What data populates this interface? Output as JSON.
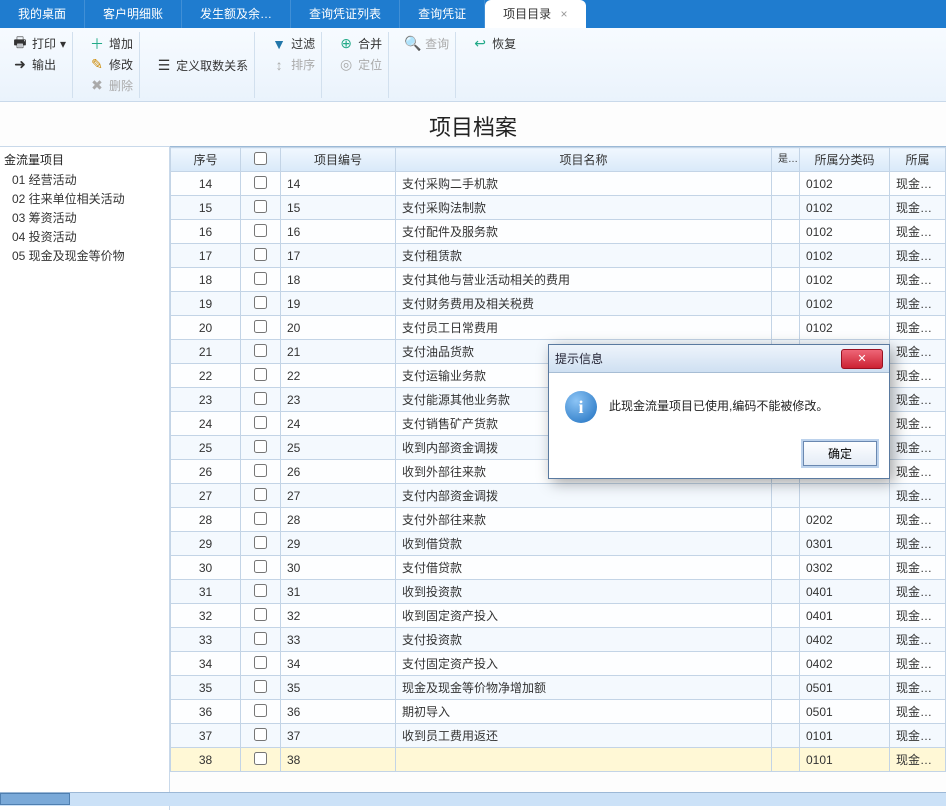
{
  "tabs": [
    {
      "label": "我的桌面",
      "active": false
    },
    {
      "label": "客户明细账",
      "active": false
    },
    {
      "label": "发生额及余…",
      "active": false
    },
    {
      "label": "查询凭证列表",
      "active": false
    },
    {
      "label": "查询凭证",
      "active": false
    },
    {
      "label": "项目目录",
      "active": true
    }
  ],
  "ribbon": {
    "print": "打印",
    "export": "输出",
    "add": "增加",
    "edit": "修改",
    "delete": "删除",
    "define": "定义取数关系",
    "filter": "过滤",
    "sort": "排序",
    "merge": "合并",
    "locate": "定位",
    "query": "查询",
    "restore": "恢复"
  },
  "page_title": "项目档案",
  "tree": {
    "root": "金流量项目",
    "items": [
      {
        "label": "01 经营活动"
      },
      {
        "label": "02 往来单位相关活动"
      },
      {
        "label": "03 筹资活动"
      },
      {
        "label": "04 投资活动"
      },
      {
        "label": "05 现金及现金等价物"
      }
    ]
  },
  "columns": {
    "seq": "序号",
    "chk": "",
    "code": "项目编号",
    "name": "项目名称",
    "settle": "是否结算",
    "cls": "所属分类码",
    "dir": "所属"
  },
  "rows": [
    {
      "seq": "14",
      "code": "14",
      "name": "支付采购二手机款",
      "cls": "0102",
      "dir": "现金流出"
    },
    {
      "seq": "15",
      "code": "15",
      "name": "支付采购法制款",
      "cls": "0102",
      "dir": "现金流出"
    },
    {
      "seq": "16",
      "code": "16",
      "name": "支付配件及服务款",
      "cls": "0102",
      "dir": "现金流出"
    },
    {
      "seq": "17",
      "code": "17",
      "name": "支付租赁款",
      "cls": "0102",
      "dir": "现金流出"
    },
    {
      "seq": "18",
      "code": "18",
      "name": "支付其他与营业活动相关的费用",
      "cls": "0102",
      "dir": "现金流出"
    },
    {
      "seq": "19",
      "code": "19",
      "name": "支付财务费用及相关税费",
      "cls": "0102",
      "dir": "现金流出"
    },
    {
      "seq": "20",
      "code": "20",
      "name": "支付员工日常费用",
      "cls": "0102",
      "dir": "现金流出"
    },
    {
      "seq": "21",
      "code": "21",
      "name": "支付油品货款",
      "cls": "",
      "dir": "现金流出"
    },
    {
      "seq": "22",
      "code": "22",
      "name": "支付运输业务款",
      "cls": "",
      "dir": "现金流出"
    },
    {
      "seq": "23",
      "code": "23",
      "name": "支付能源其他业务款",
      "cls": "",
      "dir": "现金流出"
    },
    {
      "seq": "24",
      "code": "24",
      "name": "支付销售矿产货款",
      "cls": "",
      "dir": "现金流出"
    },
    {
      "seq": "25",
      "code": "25",
      "name": "收到内部资金调拨",
      "cls": "",
      "dir": "现金流入"
    },
    {
      "seq": "26",
      "code": "26",
      "name": "收到外部往来款",
      "cls": "",
      "dir": "现金流入"
    },
    {
      "seq": "27",
      "code": "27",
      "name": "支付内部资金调拨",
      "cls": "",
      "dir": "现金流出"
    },
    {
      "seq": "28",
      "code": "28",
      "name": "支付外部往来款",
      "cls": "0202",
      "dir": "现金流出"
    },
    {
      "seq": "29",
      "code": "29",
      "name": "收到借贷款",
      "cls": "0301",
      "dir": "现金流入"
    },
    {
      "seq": "30",
      "code": "30",
      "name": "支付借贷款",
      "cls": "0302",
      "dir": "现金流出"
    },
    {
      "seq": "31",
      "code": "31",
      "name": "收到投资款",
      "cls": "0401",
      "dir": "现金流入"
    },
    {
      "seq": "32",
      "code": "32",
      "name": "收到固定资产投入",
      "cls": "0401",
      "dir": "现金流入"
    },
    {
      "seq": "33",
      "code": "33",
      "name": "支付投资款",
      "cls": "0402",
      "dir": "现金流出"
    },
    {
      "seq": "34",
      "code": "34",
      "name": "支付固定资产投入",
      "cls": "0402",
      "dir": "现金流出"
    },
    {
      "seq": "35",
      "code": "35",
      "name": "现金及现金等价物净增加额",
      "cls": "0501",
      "dir": "现金流入"
    },
    {
      "seq": "36",
      "code": "36",
      "name": "期初导入",
      "cls": "0501",
      "dir": "现金流入"
    },
    {
      "seq": "37",
      "code": "37",
      "name": "收到员工费用返还",
      "cls": "0101",
      "dir": "现金流入"
    },
    {
      "seq": "38",
      "code": "38",
      "name": "",
      "cls": "0101",
      "dir": "现金流出",
      "selected": true
    }
  ],
  "dialog": {
    "title": "提示信息",
    "message": "此现金流量项目已使用,编码不能被修改。",
    "ok": "确定"
  }
}
